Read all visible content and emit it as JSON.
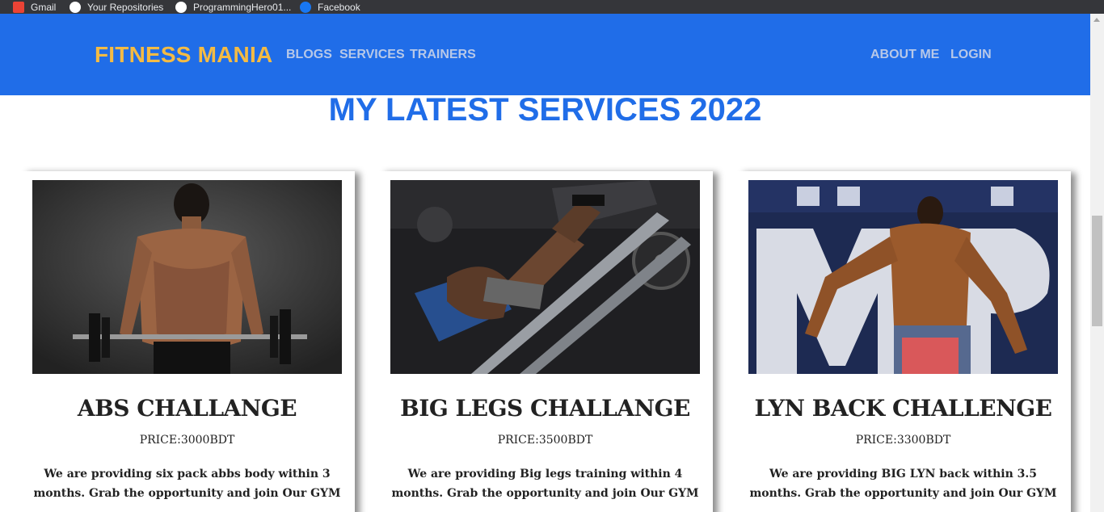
{
  "bookmarks": [
    {
      "label": "Gmail",
      "icon": "gmail-icon"
    },
    {
      "label": "Your Repositories",
      "icon": "github-icon"
    },
    {
      "label": "ProgrammingHero01...",
      "icon": "github-icon"
    },
    {
      "label": "Facebook",
      "icon": "facebook-icon"
    }
  ],
  "navbar": {
    "brand": "FITNESS MANIA",
    "links": [
      "BLOGS",
      "SERVICES",
      "TRAINERS"
    ],
    "right_links": [
      "ABOUT ME",
      "LOGIN"
    ],
    "bg_color": "#206de8",
    "brand_color": "#f4bb44"
  },
  "section": {
    "title": "MY LATEST SERVICES 2022"
  },
  "services": [
    {
      "title": "ABS CHALLANGE",
      "price": "PRICE:3000BDT",
      "description": "We are providing six pack abbs body within 3 months. Grab the opportunity and join Our GYM",
      "image": "man-doing-barbell-curl-photo"
    },
    {
      "title": "BIG LEGS CHALLANGE",
      "price": "PRICE:3500BDT",
      "description": "We are providing Big legs training within 4 months. Grab the opportunity and join Our GYM",
      "image": "man-on-leg-press-machine-photo"
    },
    {
      "title": "LYN BACK CHALLENGE",
      "price": "PRICE:3300BDT",
      "description": "We are providing BIG LYN back within 3.5 months. Grab the opportunity and join Our GYM",
      "image": "bodybuilder-back-pose-photo"
    }
  ]
}
